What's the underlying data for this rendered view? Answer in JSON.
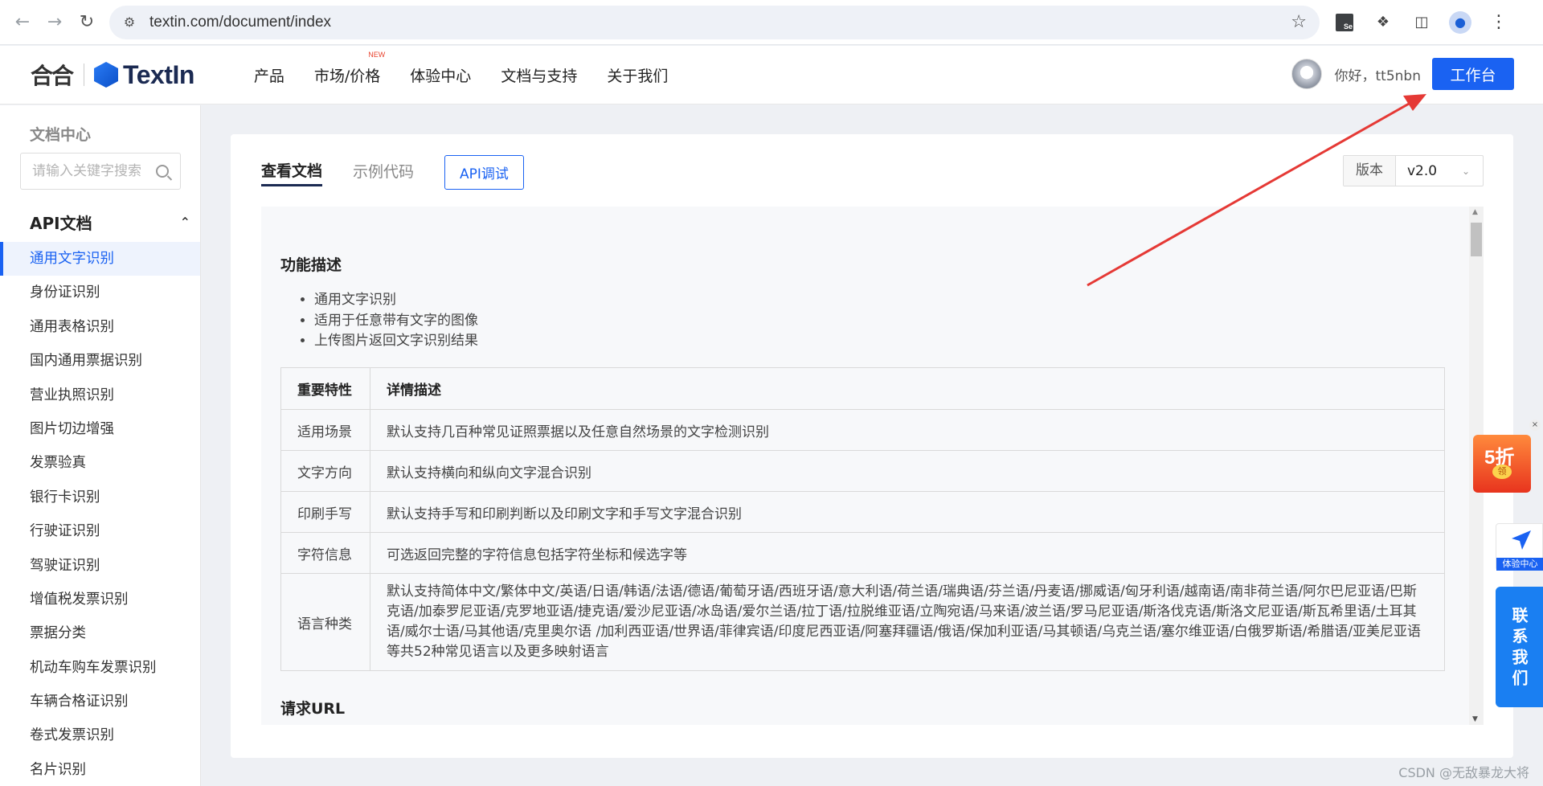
{
  "browser": {
    "url": "textin.com/document/index"
  },
  "header": {
    "nav": [
      {
        "label": "产品",
        "badge": ""
      },
      {
        "label": "市场/价格",
        "badge": "NEW"
      },
      {
        "label": "体验中心",
        "badge": ""
      },
      {
        "label": "文档与支持",
        "badge": ""
      },
      {
        "label": "关于我们",
        "badge": ""
      }
    ],
    "logo": "TextIn",
    "greeting": "你好，tt5nbn",
    "workbench_label": "工作台"
  },
  "sidebar": {
    "title": "文档中心",
    "search_placeholder": "请输入关键字搜索",
    "section": "API文档",
    "items": [
      {
        "label": "通用文字识别",
        "active": true
      },
      {
        "label": "身份证识别"
      },
      {
        "label": "通用表格识别"
      },
      {
        "label": "国内通用票据识别"
      },
      {
        "label": "营业执照识别"
      },
      {
        "label": "图片切边增强"
      },
      {
        "label": "发票验真"
      },
      {
        "label": "银行卡识别"
      },
      {
        "label": "行驶证识别"
      },
      {
        "label": "驾驶证识别"
      },
      {
        "label": "增值税发票识别"
      },
      {
        "label": "票据分类"
      },
      {
        "label": "机动车购车发票识别"
      },
      {
        "label": "车辆合格证识别"
      },
      {
        "label": "卷式发票识别"
      },
      {
        "label": "名片识别"
      }
    ]
  },
  "main": {
    "tabs": [
      {
        "label": "查看文档",
        "active": true
      },
      {
        "label": "示例代码"
      }
    ],
    "api_debug_label": "API调试",
    "version_label": "版本",
    "version_value": "v2.0",
    "doc": {
      "section1_title": "功能描述",
      "features": [
        "通用文字识别",
        "适用于任意带有文字的图像",
        "上传图片返回文字识别结果"
      ],
      "table_headers": [
        "重要特性",
        "详情描述"
      ],
      "table_rows": [
        [
          "适用场景",
          "默认支持几百种常见证照票据以及任意自然场景的文字检测识别"
        ],
        [
          "文字方向",
          "默认支持横向和纵向文字混合识别"
        ],
        [
          "印刷手写",
          "默认支持手写和印刷判断以及印刷文字和手写文字混合识别"
        ],
        [
          "字符信息",
          "可选返回完整的字符信息包括字符坐标和候选字等"
        ],
        [
          "语言种类",
          "默认支持简体中文/繁体中文/英语/日语/韩语/法语/德语/葡萄牙语/西班牙语/意大利语/荷兰语/瑞典语/芬兰语/丹麦语/挪威语/匈牙利语/越南语/南非荷兰语/阿尔巴尼亚语/巴斯克语/加泰罗尼亚语/克罗地亚语/捷克语/爱沙尼亚语/冰岛语/爱尔兰语/拉丁语/拉脱维亚语/立陶宛语/马来语/波兰语/罗马尼亚语/斯洛伐克语/斯洛文尼亚语/斯瓦希里语/土耳其语/威尔士语/马其他语/克里奥尔语 /加利西亚语/世界语/菲律宾语/印度尼西亚语/阿塞拜疆语/俄语/保加利亚语/马其顿语/乌克兰语/塞尔维亚语/白俄罗斯语/希腊语/亚美尼亚语等共52种常见语言以及更多映射语言"
        ]
      ],
      "section2_title": "请求URL"
    }
  },
  "floating": {
    "promo_text": "5折",
    "promo_coin": "领",
    "experience_label": "体验中心",
    "contact_label": "联系我们"
  },
  "watermark": "CSDN @无敌暴龙大将",
  "colors": {
    "primary": "#1a62f2",
    "annotation_arrow": "#e53935"
  }
}
